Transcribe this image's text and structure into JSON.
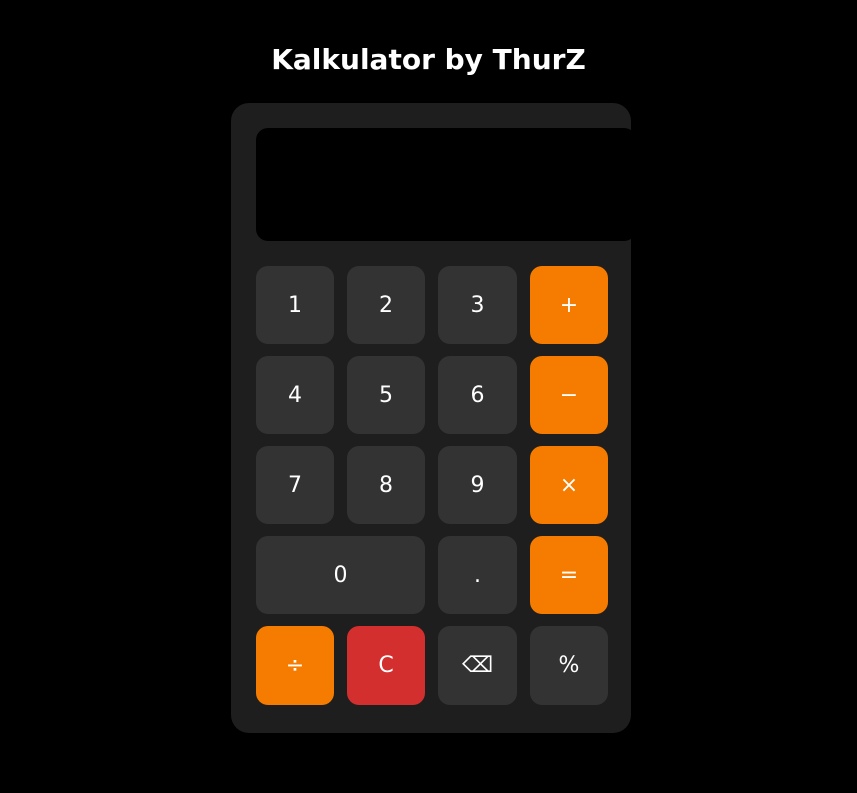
{
  "app": {
    "title": "Kalkulator by ThurZ"
  },
  "display": {
    "value": ""
  },
  "keys": {
    "one": "1",
    "two": "2",
    "three": "3",
    "plus": "+",
    "four": "4",
    "five": "5",
    "six": "6",
    "minus": "−",
    "seven": "7",
    "eight": "8",
    "nine": "9",
    "multiply": "×",
    "zero": "0",
    "dot": ".",
    "equals": "=",
    "divide": "÷",
    "clear": "C",
    "backspace": "⌫",
    "percent": "%"
  },
  "colors": {
    "background": "#000000",
    "panel": "#1e1e1e",
    "key": "#333333",
    "operator": "#f57c00",
    "clear": "#d32f2f",
    "text": "#ffffff"
  }
}
